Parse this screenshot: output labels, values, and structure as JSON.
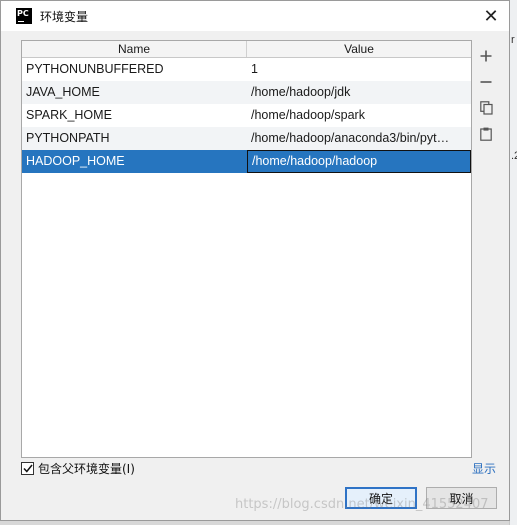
{
  "window": {
    "app_icon_text": "PC",
    "title": "环境变量",
    "close_label": "✕"
  },
  "table": {
    "columns": [
      "Name",
      "Value"
    ],
    "rows": [
      {
        "name": "PYTHONUNBUFFERED",
        "value": "1"
      },
      {
        "name": "JAVA_HOME",
        "value": "/home/hadoop/jdk"
      },
      {
        "name": "SPARK_HOME",
        "value": "/home/hadoop/spark"
      },
      {
        "name": "PYTHONPATH",
        "value": "/home/hadoop/anaconda3/bin/pyt…"
      },
      {
        "name": "HADOOP_HOME",
        "value": "/home/hadoop/hadoop"
      }
    ],
    "selected_row": 4
  },
  "side_tools": [
    {
      "icon": "plus-icon"
    },
    {
      "icon": "minus-icon"
    },
    {
      "icon": "copy-icon"
    },
    {
      "icon": "paste-icon"
    }
  ],
  "include_parent": {
    "label": "包含父环境变量(I)",
    "checked": true
  },
  "show_link": "显示",
  "buttons": {
    "ok": "确定",
    "cancel": "取消"
  },
  "watermark": "https://blog.csdn.net/weixin_41552407",
  "background_fragments": [
    "r",
    ".2"
  ],
  "colors": {
    "selection": "#2675bf",
    "link": "#2b6fbf",
    "ok_border": "#2f73c6"
  }
}
